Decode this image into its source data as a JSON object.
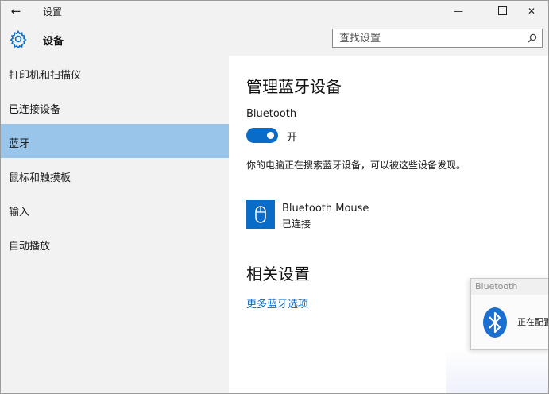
{
  "window": {
    "title": "设置",
    "back_glyph": "←",
    "minimize_glyph": "—",
    "close_glyph": "✕"
  },
  "header": {
    "title": "设备",
    "icon": "gear-icon"
  },
  "search": {
    "placeholder": "查找设置",
    "icon": "search-icon"
  },
  "sidebar": {
    "items": [
      {
        "label": "打印机和扫描仪",
        "selected": false
      },
      {
        "label": "已连接设备",
        "selected": false
      },
      {
        "label": "蓝牙",
        "selected": true
      },
      {
        "label": "鼠标和触摸板",
        "selected": false
      },
      {
        "label": "输入",
        "selected": false
      },
      {
        "label": "自动播放",
        "selected": false
      }
    ]
  },
  "main": {
    "title": "管理蓝牙设备",
    "bluetooth_label": "Bluetooth",
    "toggle_state": "开",
    "toggle_on": true,
    "status_text": "你的电脑正在搜索蓝牙设备，可以被这些设备发现。",
    "device": {
      "name": "Bluetooth Mouse",
      "status": "已连接",
      "icon": "mouse-icon"
    },
    "related_title": "相关设置",
    "more_link": "更多蓝牙选项"
  },
  "toast": {
    "title": "Bluetooth",
    "text": "正在配置",
    "icon": "bluetooth-icon"
  },
  "colors": {
    "accent": "#0a6cc9",
    "selected_item": "#99c5ea",
    "chrome": "#f2f2f2",
    "link": "#0a66c2"
  }
}
